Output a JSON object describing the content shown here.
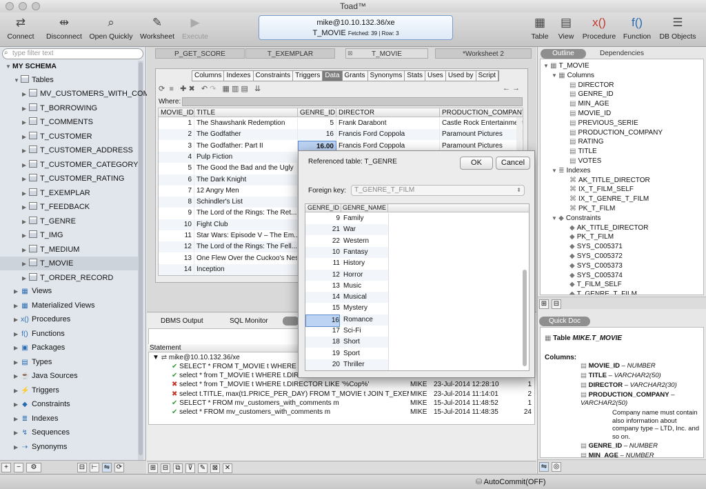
{
  "window": {
    "title": "Toad™"
  },
  "toolbar": {
    "left": [
      {
        "label": "Connect",
        "icon": "connect-icon"
      },
      {
        "label": "Disconnect",
        "icon": "disconnect-icon"
      },
      {
        "label": "Open Quickly",
        "icon": "search-icon"
      },
      {
        "label": "Worksheet",
        "icon": "worksheet-icon"
      },
      {
        "label": "Execute",
        "icon": "play-icon"
      }
    ],
    "connection": "mike@10.10.132.36/xe",
    "object": "T_MOVIE",
    "fetched": "Fetched: 39 | Row: 3",
    "right": [
      {
        "label": "Table"
      },
      {
        "label": "View"
      },
      {
        "label": "Procedure"
      },
      {
        "label": "Function"
      },
      {
        "label": "DB Objects"
      }
    ]
  },
  "sidebar": {
    "filter_placeholder": "type filter text",
    "schema": "MY SCHEMA",
    "tables_label": "Tables",
    "tables": [
      "MV_CUSTOMERS_WITH_COMM",
      "T_BORROWING",
      "T_COMMENTS",
      "T_CUSTOMER",
      "T_CUSTOMER_ADDRESS",
      "T_CUSTOMER_CATEGORY",
      "T_CUSTOMER_RATING",
      "T_EXEMPLAR",
      "T_FEEDBACK",
      "T_GENRE",
      "T_IMG",
      "T_MEDIUM",
      "T_MOVIE",
      "T_ORDER_RECORD"
    ],
    "groups": [
      "Views",
      "Materialized Views",
      "Procedures",
      "Functions",
      "Packages",
      "Types",
      "Java Sources",
      "Triggers",
      "Constraints",
      "Indexes",
      "Sequences",
      "Synonyms"
    ]
  },
  "doc_tabs": [
    "P_GET_SCORE",
    "T_EXEMPLAR",
    "T_MOVIE",
    "*Worksheet 2"
  ],
  "sub_tabs": [
    "Columns",
    "Indexes",
    "Constraints",
    "Triggers",
    "Data",
    "Grants",
    "Synonyms",
    "Stats",
    "Uses",
    "Used by",
    "Script"
  ],
  "where_label": "Where:",
  "grid": {
    "headers": [
      "MOVIE_ID",
      "TITLE",
      "GENRE_ID",
      "DIRECTOR",
      "PRODUCTION_COMPANY"
    ],
    "rows": [
      [
        "1",
        "The Shawshank Redemption",
        "5",
        "Frank Darabont",
        "Castle Rock Entertainment"
      ],
      [
        "2",
        "The Godfather",
        "16",
        "Francis Ford Coppola",
        "Paramount Pictures"
      ],
      [
        "3",
        "The Godfather: Part II",
        "16.00",
        "Francis Ford Coppola",
        "Paramount Pictures"
      ],
      [
        "4",
        "Pulp Fiction",
        "",
        "",
        ""
      ],
      [
        "5",
        "The Good the Bad and the Ugly",
        "",
        "",
        ""
      ],
      [
        "6",
        "The Dark Knight",
        "",
        "",
        ""
      ],
      [
        "7",
        "12 Angry Men",
        "",
        "",
        ""
      ],
      [
        "8",
        "Schindler's List",
        "",
        "",
        ""
      ],
      [
        "9",
        "The Lord of the Rings: The Ret...",
        "",
        "",
        ""
      ],
      [
        "10",
        "Fight Club",
        "",
        "",
        ""
      ],
      [
        "11",
        "Star Wars: Episode V – The Em...",
        "",
        "",
        ""
      ],
      [
        "12",
        "The Lord of the Rings: The Fell...",
        "",
        "",
        ""
      ],
      [
        "13",
        "One Flew Over the Cuckoo's Nest",
        "",
        "",
        ""
      ],
      [
        "14",
        "Inception",
        "",
        "",
        ""
      ]
    ]
  },
  "bottom": {
    "tabs": [
      "DBMS Output",
      "SQL Monitor"
    ],
    "statement_header": "Statement",
    "connection": "mike@10.10.132.36/xe",
    "rows": [
      {
        "sql": "SELECT * FROM T_MOVIE t WHERE t.DIRE...",
        "user": "",
        "time": "",
        "n": "",
        "ok": true
      },
      {
        "sql": "select * from T_MOVIE t WHERE t.DIRECT...",
        "user": "",
        "time": "",
        "n": "",
        "ok": true
      },
      {
        "sql": "select * from T_MOVIE t WHERE t.DIRECTOR LIKE '%Cop%'",
        "user": "MIKE",
        "time": "23-Jul-2014 12:28:10",
        "n": "1",
        "ok": false
      },
      {
        "sql": "select t.TITLE, max(t1.PRICE_PER_DAY) FROM T_MOVIE t JOIN T_EXEMPL...",
        "user": "MIKE",
        "time": "23-Jul-2014 11:14:01",
        "n": "2",
        "ok": false
      },
      {
        "sql": "SELECT * FROM mv_customers_with_comments m",
        "user": "MIKE",
        "time": "15-Jul-2014 11:48:52",
        "n": "1",
        "ok": true
      },
      {
        "sql": "select * FROM mv_customers_with_comments m",
        "user": "MIKE",
        "time": "15-Jul-2014 11:48:35",
        "n": "24",
        "ok": true
      }
    ]
  },
  "dialog": {
    "ref": "Referenced table: T_GENRE",
    "ok": "OK",
    "cancel": "Cancel",
    "fk_label": "Foreign key:",
    "fk_value": "T_GENRE_T_FILM",
    "col1": "GENRE_ID",
    "col2": "GENRE_NAME",
    "rows": [
      [
        "9",
        "Family"
      ],
      [
        "21",
        "War"
      ],
      [
        "22",
        "Western"
      ],
      [
        "10",
        "Fantasy"
      ],
      [
        "11",
        "History"
      ],
      [
        "12",
        "Horror"
      ],
      [
        "13",
        "Music"
      ],
      [
        "14",
        "Musical"
      ],
      [
        "15",
        "Mystery"
      ],
      [
        "16",
        "Romance"
      ],
      [
        "17",
        "Sci-Fi"
      ],
      [
        "18",
        "Short"
      ],
      [
        "19",
        "Sport"
      ],
      [
        "20",
        "Thriller"
      ]
    ]
  },
  "outline": {
    "tabs": [
      "Outline",
      "Dependencies"
    ],
    "root": "T_MOVIE",
    "columns_label": "Columns",
    "columns": [
      "DIRECTOR",
      "GENRE_ID",
      "MIN_AGE",
      "MOVIE_ID",
      "PREVIOUS_SERIE",
      "PRODUCTION_COMPANY",
      "RATING",
      "TITLE",
      "VOTES"
    ],
    "indexes_label": "Indexes",
    "indexes": [
      "AK_TITLE_DIRECTOR",
      "IX_T_FILM_SELF",
      "IX_T_GENRE_T_FILM",
      "PK_T_FILM"
    ],
    "constraints_label": "Constraints",
    "constraints": [
      "AK_TITLE_DIRECTOR",
      "PK_T_FILM",
      "SYS_C005371",
      "SYS_C005372",
      "SYS_C005373",
      "SYS_C005374",
      "T_FILM_SELF",
      "T_GENRE_T_FILM"
    ]
  },
  "quickdoc": {
    "tab": "Quick Doc",
    "table_prefix": "Table",
    "table_name": "MIKE.T_MOVIE",
    "columns_label": "Columns:",
    "cols": [
      {
        "name": "MOVIE_ID",
        "type": "NUMBER"
      },
      {
        "name": "TITLE",
        "type": "VARCHAR2(50)"
      },
      {
        "name": "DIRECTOR",
        "type": "VARCHAR2(30)"
      },
      {
        "name": "PRODUCTION_COMPANY",
        "type": "VARCHAR2(50)"
      }
    ],
    "note": "Company name must contain also information about company type – LTD, Inc. and so on.",
    "cols2": [
      {
        "name": "GENRE_ID",
        "type": "NUMBER"
      },
      {
        "name": "MIN_AGE",
        "type": "NUMBER"
      }
    ]
  },
  "status": {
    "autocommit": "AutoCommit(OFF)"
  }
}
